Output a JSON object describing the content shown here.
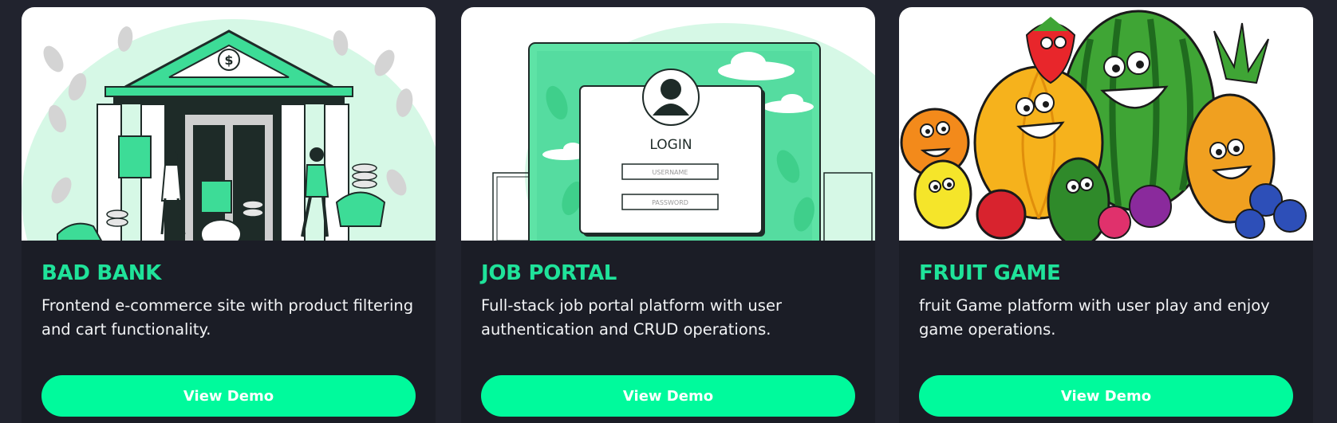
{
  "projects": [
    {
      "title": "BAD BANK",
      "description": "Frontend e-commerce site with product filtering and cart functionality.",
      "button_label": "View Demo",
      "image": "bank-building-illustration",
      "image_text": {
        "coin_symbol": "$"
      }
    },
    {
      "title": "JOB PORTAL",
      "description": "Full-stack job portal platform with user authentication and CRUD operations.",
      "button_label": "View Demo",
      "image": "login-screen-illustration",
      "image_text": {
        "login_heading": "LOGIN",
        "username_placeholder": "USERNAME",
        "password_placeholder": "PASSWORD"
      }
    },
    {
      "title": "FRUIT GAME",
      "description": "fruit Game platform with user play and enjoy game operations.",
      "button_label": "View Demo",
      "image": "cartoon-fruits-illustration"
    }
  ],
  "colors": {
    "page_bg": "#21232e",
    "card_bg": "#1b1d26",
    "accent": "#1fe39a",
    "button": "#00fa9c"
  }
}
